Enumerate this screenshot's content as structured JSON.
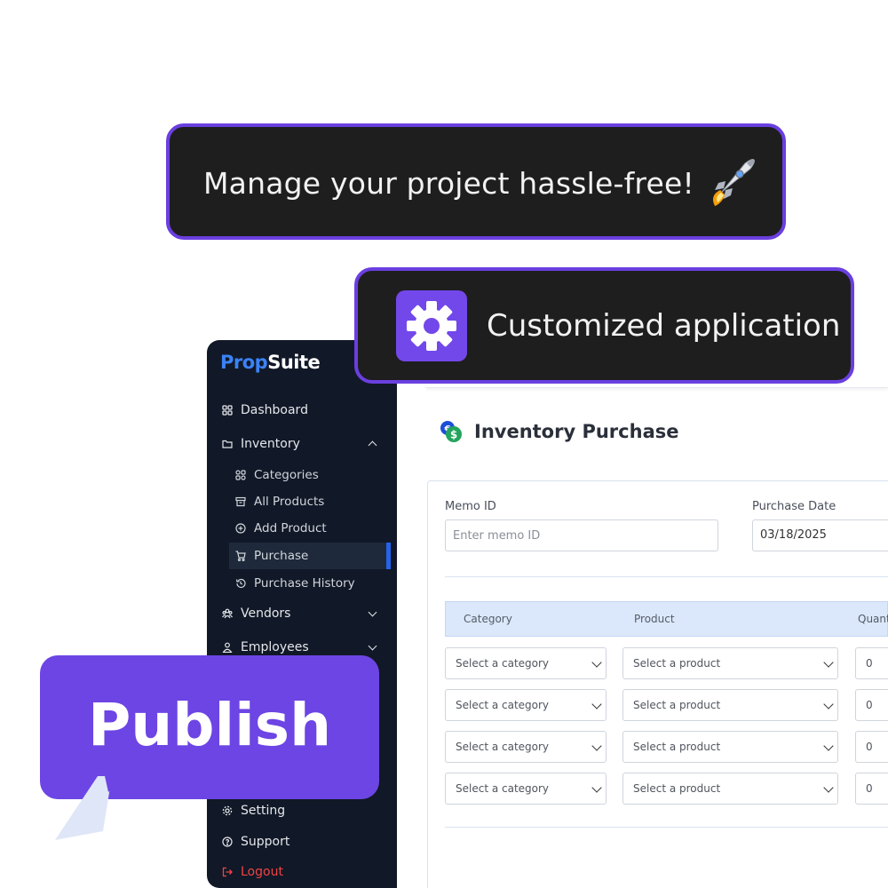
{
  "banners": {
    "tagline": "Manage your project hassle-free!",
    "feature": "Customized application",
    "publish_label": "Publish"
  },
  "icons": {
    "rocket": "rocket-icon",
    "gear": "gear-icon",
    "money": "money-icon"
  },
  "colors": {
    "accent_purple": "#6c45e4",
    "sidebar_bg": "#111827",
    "brand_blue": "#3b82f6",
    "logout_red": "#ef4444"
  },
  "sidebar": {
    "logo_part1": "Prop",
    "logo_part2": "Suite",
    "items": [
      {
        "label": "Dashboard"
      },
      {
        "label": "Inventory"
      },
      {
        "label": "Vendors"
      },
      {
        "label": "Employees"
      },
      {
        "label": "Setting"
      },
      {
        "label": "Support"
      },
      {
        "label": "Logout"
      }
    ],
    "inventory_sub": [
      {
        "label": "Categories"
      },
      {
        "label": "All Products"
      },
      {
        "label": "Add Product"
      },
      {
        "label": "Purchase"
      },
      {
        "label": "Purchase History"
      }
    ],
    "active_item": "Purchase"
  },
  "main": {
    "page_title": "Inventory Purchase",
    "memo_label": "Memo ID",
    "memo_placeholder": "Enter memo ID",
    "date_label": "Purchase Date",
    "date_value": "03/18/2025",
    "table": {
      "headers": [
        "Category",
        "Product",
        "Quant"
      ],
      "rows": [
        {
          "category": "Select a category",
          "product": "Select a product",
          "qty": "0"
        },
        {
          "category": "Select a category",
          "product": "Select a product",
          "qty": "0"
        },
        {
          "category": "Select a category",
          "product": "Select a product",
          "qty": "0"
        },
        {
          "category": "Select a category",
          "product": "Select a product",
          "qty": "0"
        }
      ]
    }
  }
}
